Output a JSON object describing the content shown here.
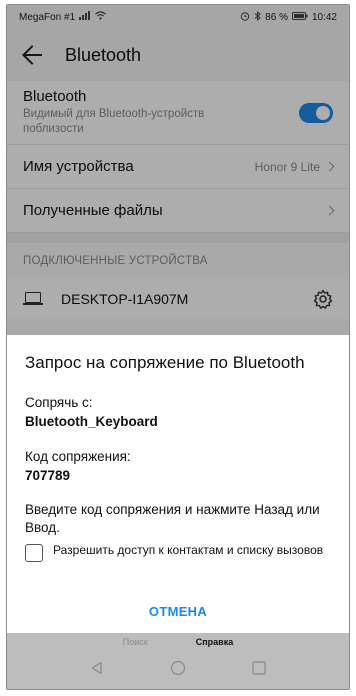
{
  "statusbar": {
    "carrier": "MegaFon #1",
    "signal_icon": "signal-icon",
    "wifi_icon": "wifi-icon",
    "alarm_icon": "alarm-icon",
    "bluetooth_icon": "bluetooth-icon",
    "battery_percent": "86 %",
    "time": "10:42"
  },
  "appbar": {
    "title": "Bluetooth"
  },
  "bluetooth_row": {
    "title": "Bluetooth",
    "subtitle": "Видимый для Bluetooth-устройств поблизости",
    "enabled": true
  },
  "device_name_row": {
    "label": "Имя устройства",
    "value": "Honor 9 Lite"
  },
  "received_files_row": {
    "label": "Полученные файлы"
  },
  "connected_section": {
    "header": "ПОДКЛЮЧЕННЫЕ УСТРОЙСТВА",
    "devices": [
      {
        "name": "DESKTOP-I1A907M"
      }
    ]
  },
  "dialog": {
    "title": "Запрос на сопряжение по Bluetooth",
    "pair_with_label": "Сопрячь с:",
    "pair_with_value": "Bluetooth_Keyboard",
    "code_label": "Код сопряжения:",
    "code_value": "707789",
    "instruction": "Введите код сопряжения и нажмите Назад или Ввод.",
    "checkbox_label": "Разрешить доступ к контактам и списку вызовов",
    "checkbox_checked": false,
    "cancel_label": "ОТМЕНА"
  },
  "keyboard_hint": {
    "left": "Поиск",
    "right": "Справка"
  },
  "colors": {
    "accent": "#1e88e5",
    "scrim": "rgba(0,0,0,0.32)"
  }
}
